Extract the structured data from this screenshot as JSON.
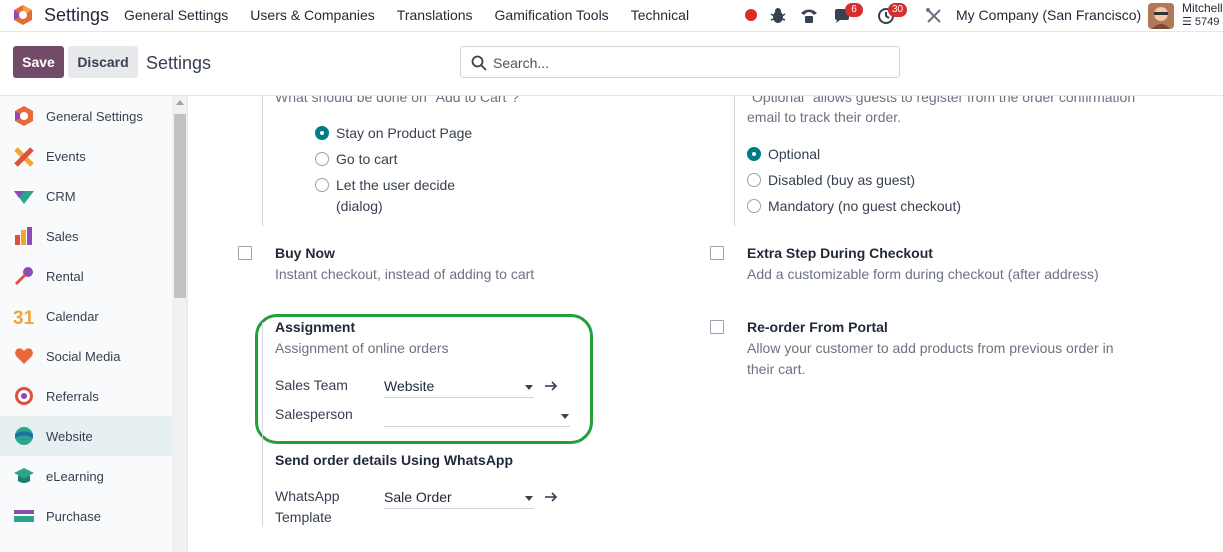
{
  "navbar": {
    "app_title": "Settings",
    "menu": [
      "General Settings",
      "Users & Companies",
      "Translations",
      "Gamification Tools",
      "Technical"
    ],
    "messages_badge": "6",
    "activities_badge": "30",
    "company": "My Company (San Francisco)",
    "user_name": "Mitchell",
    "user_coins": "5749"
  },
  "control": {
    "save_label": "Save",
    "discard_label": "Discard",
    "page_title": "Settings",
    "search_placeholder": "Search..."
  },
  "sidebar": {
    "items": [
      {
        "label": "General Settings",
        "icon": "general-settings-icon"
      },
      {
        "label": "Events",
        "icon": "events-icon"
      },
      {
        "label": "CRM",
        "icon": "crm-icon"
      },
      {
        "label": "Sales",
        "icon": "sales-icon"
      },
      {
        "label": "Rental",
        "icon": "rental-icon"
      },
      {
        "label": "Calendar",
        "icon": "calendar-icon"
      },
      {
        "label": "Social Media",
        "icon": "social-media-icon"
      },
      {
        "label": "Referrals",
        "icon": "referrals-icon"
      },
      {
        "label": "Website",
        "icon": "website-icon",
        "active": true
      },
      {
        "label": "eLearning",
        "icon": "elearning-icon"
      },
      {
        "label": "Purchase",
        "icon": "purchase-icon"
      }
    ]
  },
  "content": {
    "add_to_cart": {
      "question": "What should be done on \"Add to Cart\"?",
      "options": [
        "Stay on Product Page",
        "Go to cart",
        "Let the user decide",
        "(dialog)"
      ],
      "selected": "Stay on Product Page"
    },
    "guest_checkout": {
      "desc_line1": "\"Optional\" allows guests to register from the order confirmation",
      "desc_line2": "email to track their order.",
      "options": [
        "Optional",
        "Disabled (buy as guest)",
        "Mandatory (no guest checkout)"
      ],
      "selected": "Optional"
    },
    "buy_now": {
      "title": "Buy Now",
      "desc": "Instant checkout, instead of adding to cart",
      "checked": false
    },
    "extra_step": {
      "title": "Extra Step During Checkout",
      "desc": "Add a customizable form during checkout (after address)",
      "checked": false
    },
    "assignment": {
      "title": "Assignment",
      "desc": "Assignment of online orders",
      "sales_team_label": "Sales Team",
      "sales_team_value": "Website",
      "salesperson_label": "Salesperson",
      "salesperson_value": ""
    },
    "reorder": {
      "title": "Re-order From Portal",
      "desc_line1": "Allow your customer to add products from previous order in",
      "desc_line2": "their cart.",
      "checked": false
    },
    "whatsapp": {
      "title": "Send order details Using WhatsApp",
      "template_label_1": "WhatsApp",
      "template_label_2": "Template",
      "template_value": "Sale Order"
    }
  },
  "colors": {
    "brand": "#714b67",
    "accent": "#017e84",
    "highlight": "#22a03a",
    "badge": "#d62e2e"
  }
}
